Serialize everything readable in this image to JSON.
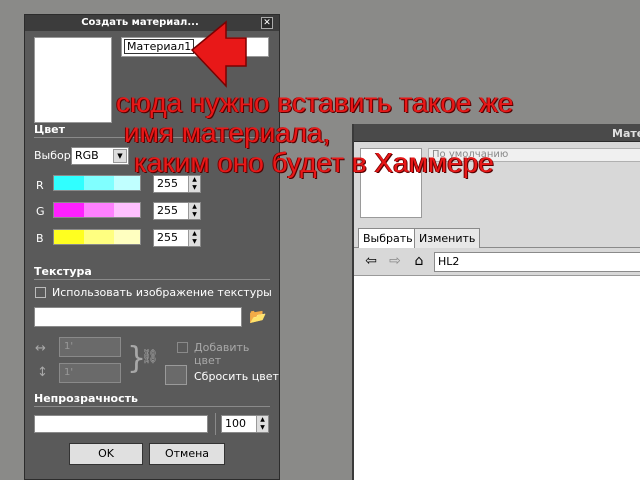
{
  "background_window": {
    "title": "Матер",
    "default_field": "По умолчанию",
    "tabs": [
      "Выбрать",
      "Изменить"
    ],
    "path": "HL2"
  },
  "dialog": {
    "title": "Создать материал...",
    "material_name": "Материал1",
    "color_section": "Цвет",
    "select_label": "Выбор:",
    "color_model": "RGB",
    "channels": [
      {
        "label": "R",
        "value": "255",
        "colors": [
          "#30ffff",
          "#80ffff",
          "#c0ffff"
        ]
      },
      {
        "label": "G",
        "value": "255",
        "colors": [
          "#ff20ff",
          "#ff80ff",
          "#ffc0ff"
        ]
      },
      {
        "label": "B",
        "value": "255",
        "colors": [
          "#ffff20",
          "#ffff80",
          "#ffffc0"
        ]
      }
    ],
    "texture_section": "Текстура",
    "use_texture_label": "Использовать изображение текстуры",
    "width_value": "1'",
    "height_value": "1'",
    "add_color_label": "Добавить цвет",
    "reset_color_label": "Сбросить цвет",
    "opacity_section": "Непрозрачность",
    "opacity_value": "100",
    "ok_label": "OK",
    "cancel_label": "Отмена"
  },
  "annotation": {
    "lines": [
      "сюда нужно вставить такое же",
      "имя материала,",
      "каким оно будет в Хаммере"
    ],
    "color": "#e81818"
  }
}
